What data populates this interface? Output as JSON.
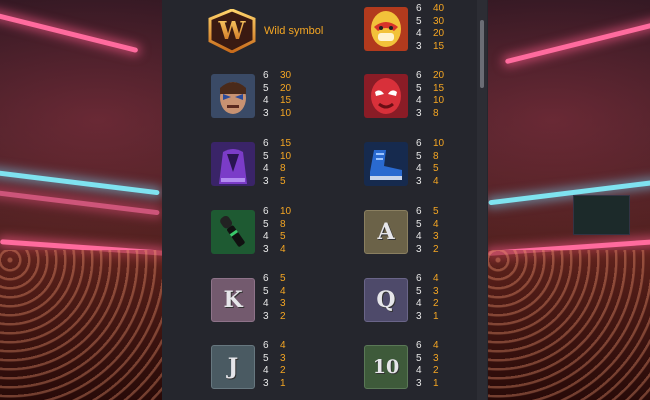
{
  "wild": {
    "label": "Wild symbol",
    "letter": "W"
  },
  "symbols": [
    {
      "name": "wrestler-yellow-mask",
      "pays": [
        [
          "6",
          "40"
        ],
        [
          "5",
          "30"
        ],
        [
          "4",
          "20"
        ],
        [
          "3",
          "15"
        ]
      ]
    },
    {
      "name": "wrestler-face-paint",
      "pays": [
        [
          "6",
          "30"
        ],
        [
          "5",
          "20"
        ],
        [
          "4",
          "15"
        ],
        [
          "3",
          "10"
        ]
      ]
    },
    {
      "name": "wrestler-red-mask",
      "pays": [
        [
          "6",
          "20"
        ],
        [
          "5",
          "15"
        ],
        [
          "4",
          "10"
        ],
        [
          "3",
          "8"
        ]
      ]
    },
    {
      "name": "purple-robe",
      "pays": [
        [
          "6",
          "15"
        ],
        [
          "5",
          "10"
        ],
        [
          "4",
          "8"
        ],
        [
          "3",
          "5"
        ]
      ]
    },
    {
      "name": "blue-boots",
      "pays": [
        [
          "6",
          "10"
        ],
        [
          "5",
          "8"
        ],
        [
          "4",
          "5"
        ],
        [
          "3",
          "4"
        ]
      ]
    },
    {
      "name": "microphone",
      "pays": [
        [
          "6",
          "10"
        ],
        [
          "5",
          "8"
        ],
        [
          "4",
          "5"
        ],
        [
          "3",
          "4"
        ]
      ]
    },
    {
      "name": "letter-a",
      "letter": "A",
      "pays": [
        [
          "6",
          "5"
        ],
        [
          "5",
          "4"
        ],
        [
          "4",
          "3"
        ],
        [
          "3",
          "2"
        ]
      ]
    },
    {
      "name": "letter-k",
      "letter": "K",
      "pays": [
        [
          "6",
          "5"
        ],
        [
          "5",
          "4"
        ],
        [
          "4",
          "3"
        ],
        [
          "3",
          "2"
        ]
      ]
    },
    {
      "name": "letter-q",
      "letter": "Q",
      "pays": [
        [
          "6",
          "4"
        ],
        [
          "5",
          "3"
        ],
        [
          "4",
          "2"
        ],
        [
          "3",
          "1"
        ]
      ]
    },
    {
      "name": "letter-j",
      "letter": "J",
      "pays": [
        [
          "6",
          "4"
        ],
        [
          "5",
          "3"
        ],
        [
          "4",
          "2"
        ],
        [
          "3",
          "1"
        ]
      ]
    },
    {
      "name": "number-10",
      "letter": "10",
      "pays": [
        [
          "6",
          "4"
        ],
        [
          "5",
          "3"
        ],
        [
          "4",
          "2"
        ],
        [
          "3",
          "1"
        ]
      ]
    }
  ],
  "colors": {
    "payout": "#f5a623",
    "count": "#e8e8e8",
    "panel": "#25262d"
  }
}
